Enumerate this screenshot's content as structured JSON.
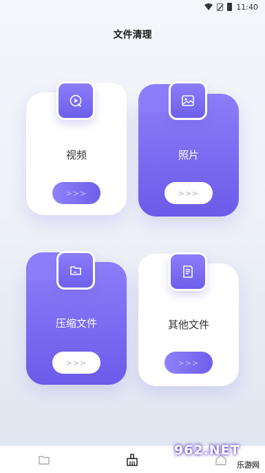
{
  "status_bar": {
    "time": "11:40"
  },
  "header": {
    "title": "文件清理"
  },
  "cards": [
    {
      "label": "视频",
      "button": ">>>",
      "icon": "video-play-icon",
      "style": "white"
    },
    {
      "label": "照片",
      "button": ">>>",
      "icon": "image-icon",
      "style": "purple"
    },
    {
      "label": "压缩文件",
      "button": ">>>",
      "icon": "folder-icon",
      "style": "purple"
    },
    {
      "label": "其他文件",
      "button": ">>>",
      "icon": "document-icon",
      "style": "white"
    }
  ],
  "bottom_nav": {
    "items": [
      {
        "icon": "folder-outline-icon"
      },
      {
        "icon": "broom-icon",
        "active": true
      },
      {
        "icon": "home-icon"
      }
    ]
  },
  "watermark": {
    "top": "962.NET",
    "bottom": "乐游网"
  },
  "colors": {
    "accent": "#7b6cf6",
    "accent_dark": "#6b5be9",
    "text": "#1a1a1a"
  }
}
